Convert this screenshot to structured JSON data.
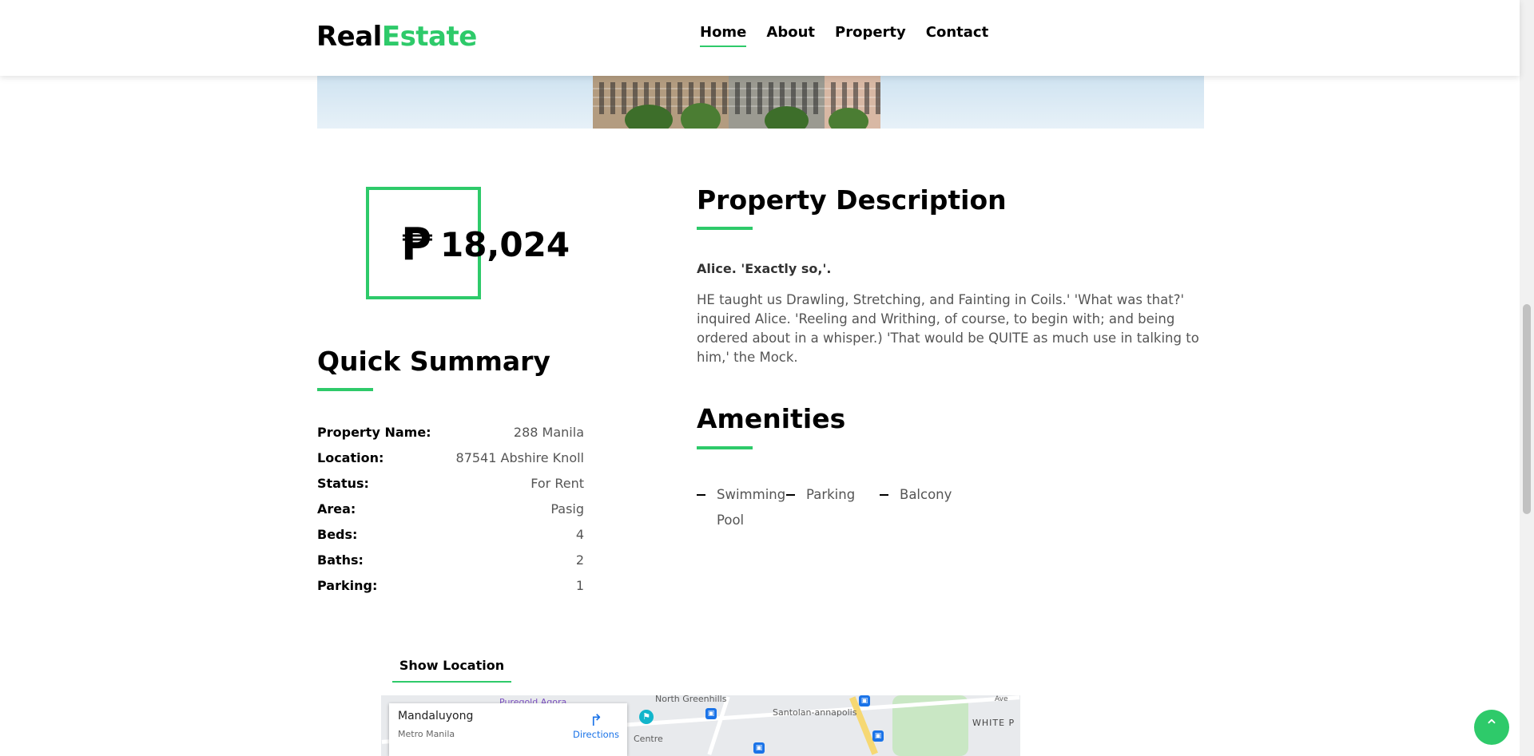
{
  "header": {
    "logo_part1": "Real",
    "logo_part2": "Estate",
    "nav": [
      "Home",
      "About",
      "Property",
      "Contact"
    ],
    "active_nav": "Home"
  },
  "price": {
    "symbol": "₱",
    "amount": "18,024"
  },
  "summary": {
    "title": "Quick Summary",
    "rows": [
      {
        "label": "Property Name:",
        "value": "288 Manila"
      },
      {
        "label": "Location:",
        "value": "87541 Abshire Knoll"
      },
      {
        "label": "Status:",
        "value": "For Rent"
      },
      {
        "label": "Area:",
        "value": "Pasig"
      },
      {
        "label": "Beds:",
        "value": "4"
      },
      {
        "label": "Baths:",
        "value": "2"
      },
      {
        "label": "Parking:",
        "value": "1"
      }
    ]
  },
  "description": {
    "title": "Property Description",
    "lead": "Alice. 'Exactly so,'.",
    "body": "HE taught us Drawling, Stretching, and Fainting in Coils.' 'What was that?' inquired Alice. 'Reeling and Writhing, of course, to begin with; and being ordered about in a whisper.) 'That would be QUITE as much use in talking to him,' the Mock."
  },
  "amenities": {
    "title": "Amenities",
    "items": [
      "Swimming Pool",
      "Parking",
      "Balcony"
    ]
  },
  "location_tab": "Show Location",
  "map": {
    "place": "Mandaluyong",
    "region": "Metro Manila",
    "directions": "Directions",
    "labels": {
      "north_greenhills": "North Greenhills",
      "puregold": "Puregold Agora",
      "santolan": "Santolan-annapolis",
      "white": "WHITE P",
      "centre": "Centre",
      "ave": "Ave"
    }
  },
  "colors": {
    "accent": "#2eca6a"
  }
}
